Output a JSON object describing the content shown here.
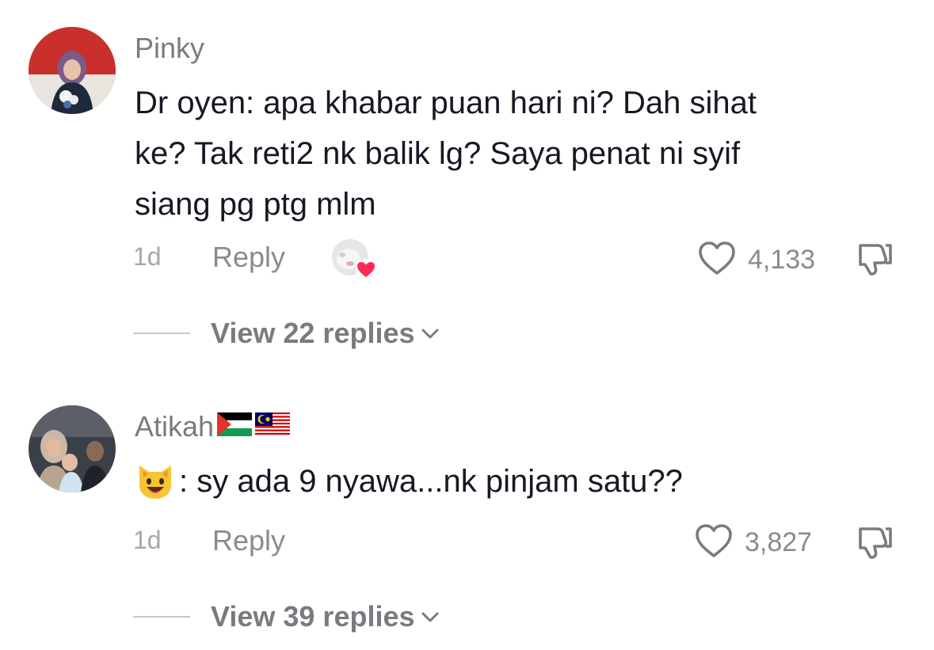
{
  "comments": [
    {
      "username": "Pinky",
      "text_lines": [
        "Dr oyen: apa khabar puan hari ni? Dah sihat",
        "ke? Tak reti2 nk balik lg? Saya penat ni syif",
        "siang pg ptg mlm"
      ],
      "time": "1d",
      "reply_label": "Reply",
      "like_count": "4,133",
      "view_replies": "View 22 replies",
      "icons": {
        "avatar": "avatar-photo",
        "creator_liked": "creator-liked-avatar-with-heart",
        "like": "heart-outline-icon",
        "dislike": "thumbs-down-icon",
        "expand": "chevron-down-icon"
      }
    },
    {
      "username": "Atikah",
      "username_flags": [
        "🇵🇸",
        "🇲🇾"
      ],
      "emoji": "😺",
      "text": ": sy ada 9 nyawa...nk pinjam satu??",
      "time": "1d",
      "reply_label": "Reply",
      "like_count": "3,827",
      "view_replies": "View 39 replies",
      "icons": {
        "avatar": "avatar-photo",
        "like": "heart-outline-icon",
        "dislike": "thumbs-down-icon",
        "expand": "chevron-down-icon"
      }
    }
  ],
  "colors": {
    "text": "#161823",
    "username": "#7a7b80",
    "muted": "#8a8b91",
    "heart_badge": "#fe2c55"
  }
}
